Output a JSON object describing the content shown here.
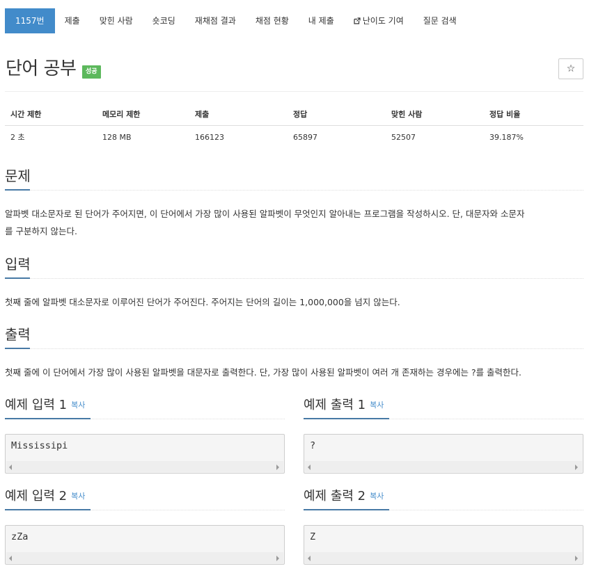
{
  "nav": {
    "tabs": [
      {
        "label": "1157번"
      },
      {
        "label": "제출"
      },
      {
        "label": "맞힌 사람"
      },
      {
        "label": "숏코딩"
      },
      {
        "label": "재채점 결과"
      },
      {
        "label": "채점 현황"
      },
      {
        "label": "내 제출"
      },
      {
        "label": "난이도 기여"
      },
      {
        "label": "질문 검색"
      }
    ]
  },
  "problem": {
    "title": "단어 공부",
    "badge": "성공",
    "star": "☆"
  },
  "info": {
    "headers": [
      "시간 제한",
      "메모리 제한",
      "제출",
      "정답",
      "맞힌 사람",
      "정답 비율"
    ],
    "values": [
      "2 초",
      "128 MB",
      "166123",
      "65897",
      "52507",
      "39.187%"
    ]
  },
  "sections": {
    "problem": {
      "heading": "문제",
      "line1": "알파벳 대소문자로 된 단어가 주어지면, 이 단어에서 가장 많이 사용된 알파벳이 무엇인지 알아내는 프로그램을 작성하시오. 단, 대문자와 소문자",
      "line2": "를 구분하지 않는다."
    },
    "input": {
      "heading": "입력",
      "text": "첫째 줄에 알파벳 대소문자로 이루어진 단어가 주어진다. 주어지는 단어의 길이는 1,000,000을 넘지 않는다."
    },
    "output": {
      "heading": "출력",
      "text": "첫째 줄에 이 단어에서 가장 많이 사용된 알파벳을 대문자로 출력한다. 단, 가장 많이 사용된 알파벳이 여러 개 존재하는 경우에는 ?를 출력한다."
    }
  },
  "samples": {
    "copy_label": "복사",
    "in1": {
      "title": "예제 입력 1",
      "code": "Mississipi"
    },
    "out1": {
      "title": "예제 출력 1",
      "code": "?"
    },
    "in2": {
      "title": "예제 입력 2",
      "code": "zZa"
    },
    "out2": {
      "title": "예제 출력 2",
      "code": "Z"
    }
  },
  "colors": {
    "accent": "#428bca",
    "success": "#5cb85c"
  }
}
